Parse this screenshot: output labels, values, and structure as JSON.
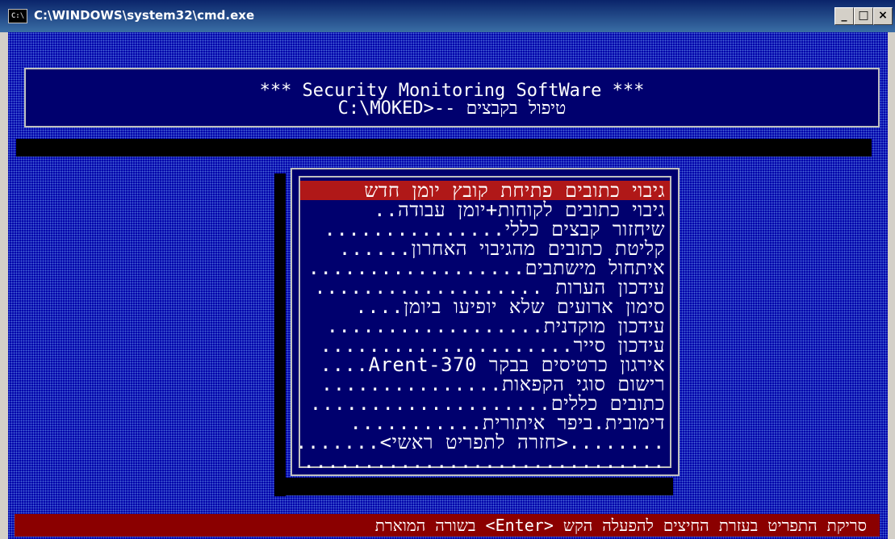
{
  "window": {
    "title": "C:\\WINDOWS\\system32\\cmd.exe",
    "icon_label": "C:\\",
    "buttons": {
      "minimize": "_",
      "maximize": "□",
      "close": "×"
    }
  },
  "header": {
    "line1": "*** Security Monitoring SoftWare ***",
    "line2": "טיפול בקבצים --<C:\\MOKED"
  },
  "menu": {
    "items": [
      {
        "label": "גיבוי כתובים פתיחת קובץ יומן חדש",
        "selected": true
      },
      {
        "label": "גיבוי כתובים לקוחות+יומן עבודה.."
      },
      {
        "label": "שיחזור קבצים כללי..............."
      },
      {
        "label": "קליטת כתובים מהגיבוי האחרון......"
      },
      {
        "label": "איתחול מישתבים.................."
      },
      {
        "label": "עידכון הערות ..................."
      },
      {
        "label": "סימון ארועים שלא יופיעו ביומן...."
      },
      {
        "label": "עידכון מוקדנית.................."
      },
      {
        "label": "עידכון סייר....................."
      },
      {
        "label": "אירגון כרטיסים בבקר Arent-370...."
      },
      {
        "label": "רישום סוגי הקפאות..............."
      },
      {
        "label": "כתובים כללים...................."
      },
      {
        "label": "דימובית.ביפר איתורית..........."
      },
      {
        "label": "........<חזרה לתפריט ראשי>......."
      },
      {
        "label": "..................................."
      }
    ]
  },
  "status": {
    "text": "סריקת התפריט בעזרת החיצים להפעלה הקש <Enter> בשורה המוארת"
  },
  "colors": {
    "console_bg": "#0000a8",
    "highlight": "#b01818",
    "status_bg": "#8b0000"
  }
}
